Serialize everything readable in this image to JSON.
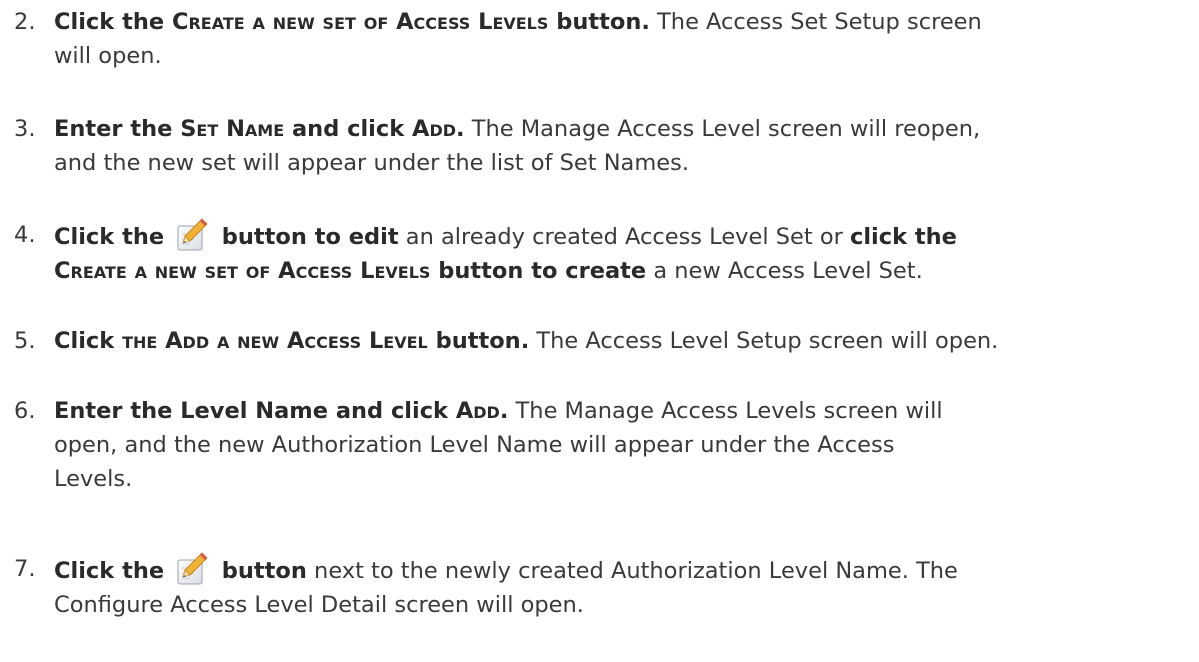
{
  "steps": [
    {
      "number": "2.",
      "lines": [
        [
          {
            "t": "b",
            "v": "Click the "
          },
          {
            "t": "sc",
            "v": "Create a new set of Access Levels"
          },
          {
            "t": "b",
            "v": " button."
          },
          {
            "t": "n",
            "v": " The Access Set Setup screen"
          }
        ],
        [
          {
            "t": "n",
            "v": "will open."
          }
        ]
      ]
    },
    {
      "number": "3.",
      "lines": [
        [
          {
            "t": "b",
            "v": "Enter the "
          },
          {
            "t": "sc",
            "v": "Set Name"
          },
          {
            "t": "b",
            "v": " and click "
          },
          {
            "t": "sc",
            "v": "Add"
          },
          {
            "t": "b",
            "v": "."
          },
          {
            "t": "n",
            "v": " The Manage Access Level screen will reopen,"
          }
        ],
        [
          {
            "t": "n",
            "v": "and the new set will appear under the list of Set Names."
          }
        ]
      ]
    },
    {
      "number": "4.",
      "lines": [
        [
          {
            "t": "b",
            "v": "Click the "
          },
          {
            "t": "icon",
            "v": "pencil-edit-icon"
          },
          {
            "t": "b",
            "v": " button to edit"
          },
          {
            "t": "n",
            "v": " an already created Access Level Set or "
          },
          {
            "t": "b",
            "v": "click the"
          }
        ],
        [
          {
            "t": "sc",
            "v": "Create a new set of Access Levels"
          },
          {
            "t": "b",
            "v": " button to create"
          },
          {
            "t": "n",
            "v": " a new Access Level Set."
          }
        ]
      ]
    },
    {
      "number": "5.",
      "lines": [
        [
          {
            "t": "b",
            "v": "Click "
          },
          {
            "t": "sc",
            "v": "the Add a new Access Level"
          },
          {
            "t": "b",
            "v": " button."
          },
          {
            "t": "n",
            "v": " The Access Level Setup screen will open."
          }
        ]
      ]
    },
    {
      "number": "6.",
      "lines": [
        [
          {
            "t": "b",
            "v": "Enter the Level Name and click "
          },
          {
            "t": "sc",
            "v": "Add"
          },
          {
            "t": "b",
            "v": "."
          },
          {
            "t": "n",
            "v": " The Manage Access Levels screen will"
          }
        ],
        [
          {
            "t": "n",
            "v": "open, and the new Authorization Level Name will appear under the Access"
          }
        ],
        [
          {
            "t": "n",
            "v": "Levels."
          }
        ]
      ]
    },
    {
      "number": "7.",
      "lines": [
        [
          {
            "t": "b",
            "v": "Click the "
          },
          {
            "t": "icon",
            "v": "pencil-edit-icon"
          },
          {
            "t": "b",
            "v": " button"
          },
          {
            "t": "n",
            "v": " next to the newly created Authorization Level Name. The"
          }
        ],
        [
          {
            "t": "n",
            "v": "Configure Access Level Detail screen will open."
          }
        ]
      ]
    }
  ]
}
